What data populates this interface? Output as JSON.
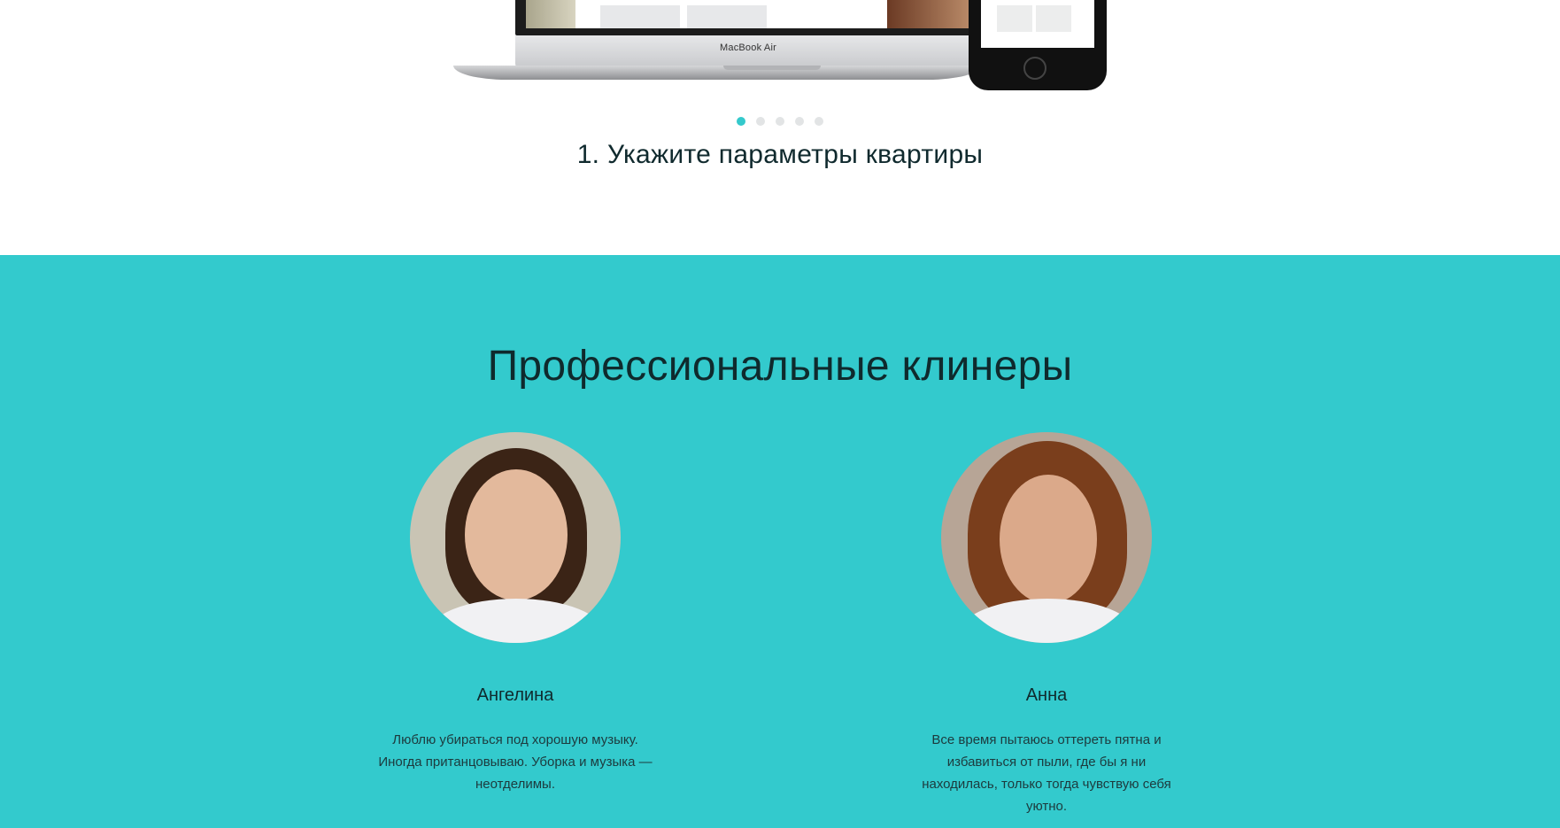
{
  "slider": {
    "laptop_brand": "MacBook Air",
    "dots_count": 5,
    "active_dot": 1,
    "caption": "1. Укажите параметры квартиры"
  },
  "team": {
    "title": "Профессиональные клинеры",
    "members": [
      {
        "name": "Ангелина",
        "text": "Люблю убираться под хорошую музыку. Иногда пританцовываю. Уборка и музыка — неотделимы."
      },
      {
        "name": "Анна",
        "text": "Все время пытаюсь оттереть пятна и избавиться от пыли, где бы я ни находилась, только тогда чувствую себя уютно."
      }
    ]
  },
  "colors": {
    "accent": "#33cacd",
    "text_dark": "#0f2a2d"
  }
}
